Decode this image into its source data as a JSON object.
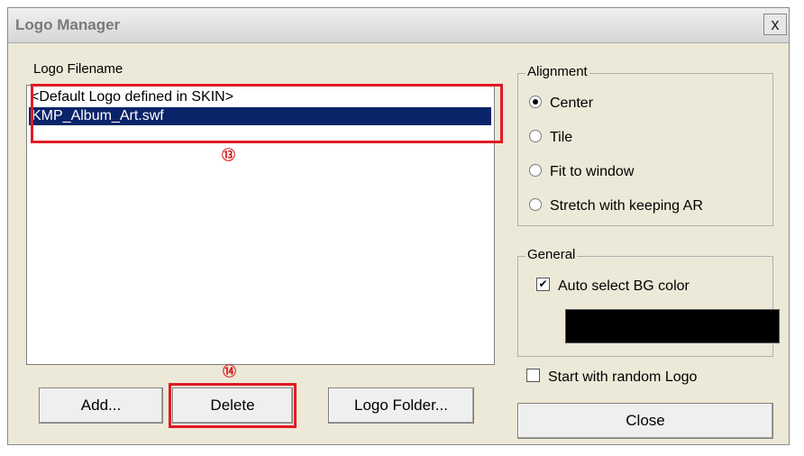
{
  "window": {
    "title": "Logo Manager",
    "close_glyph": "x"
  },
  "logo_group": {
    "legend": "Logo Filename",
    "items": [
      {
        "label": "<Default Logo defined in SKIN>",
        "selected": false
      },
      {
        "label": "KMP_Album_Art.swf",
        "selected": true
      }
    ],
    "markers": {
      "list": "⑬",
      "delete": "⑭"
    },
    "buttons": {
      "add": "Add...",
      "delete": "Delete",
      "logo_folder": "Logo Folder..."
    }
  },
  "alignment": {
    "legend": "Alignment",
    "options": [
      {
        "label": "Center",
        "selected": true
      },
      {
        "label": "Tile",
        "selected": false
      },
      {
        "label": "Fit to window",
        "selected": false
      },
      {
        "label": "Stretch with keeping AR",
        "selected": false
      }
    ]
  },
  "general": {
    "legend": "General",
    "auto_bg_label": "Auto select BG color",
    "auto_bg_checked": true,
    "bg_color": "#000000"
  },
  "random_logo": {
    "label": "Start with random Logo",
    "checked": false
  },
  "close_button": {
    "label": "Close"
  },
  "colors": {
    "highlight": "#0a246a",
    "annotation": "#e01b24"
  }
}
